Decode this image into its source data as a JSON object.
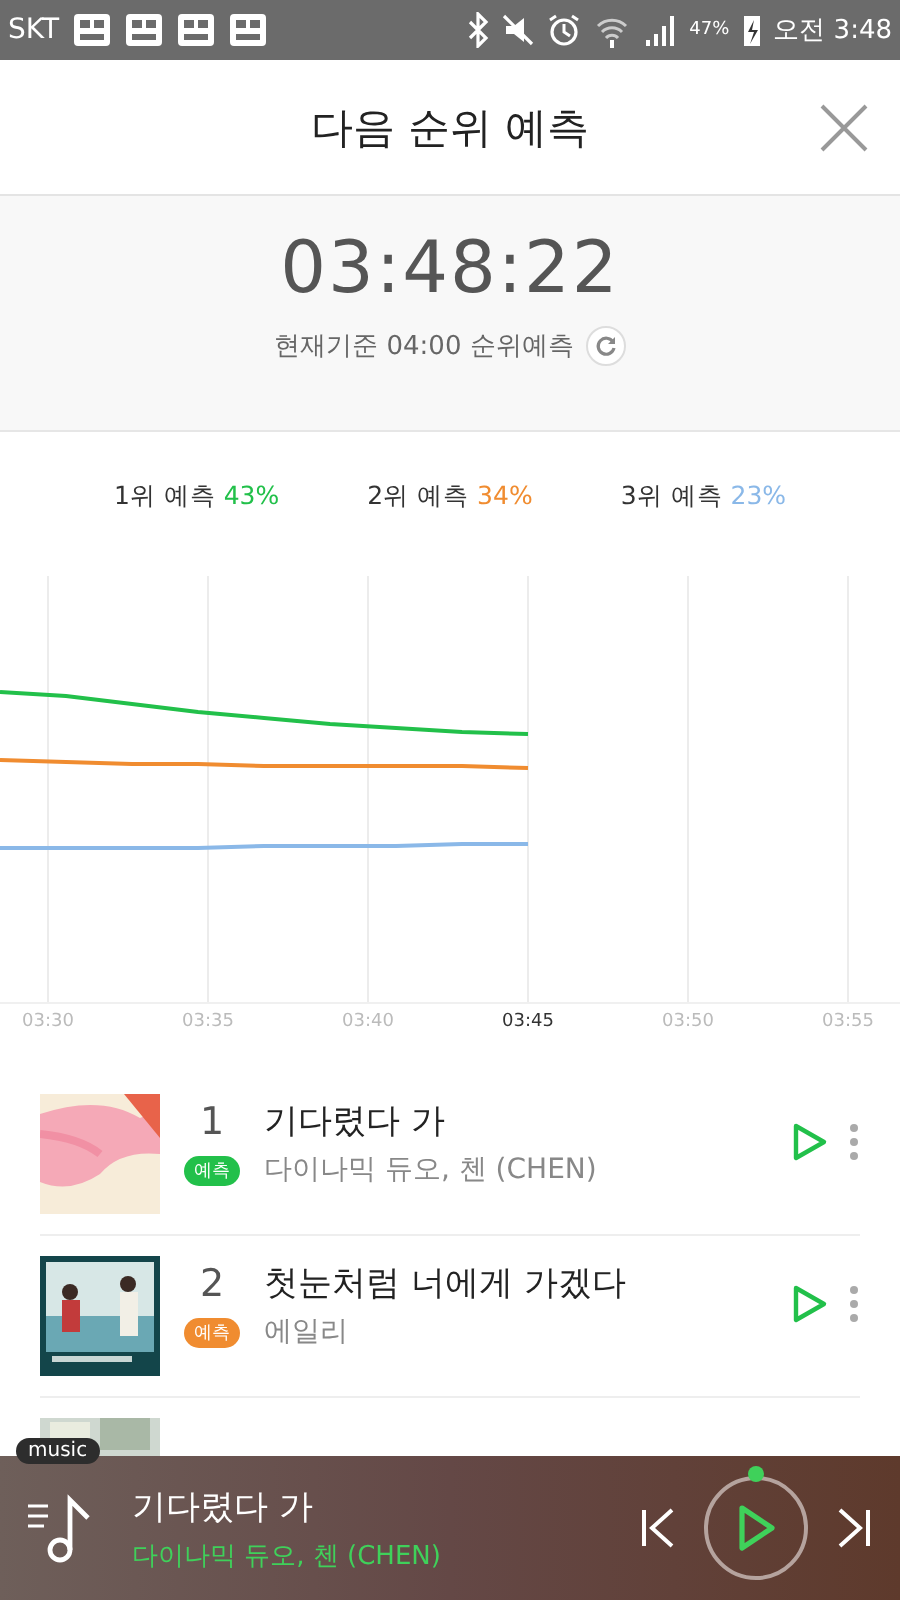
{
  "status_bar": {
    "carrier": "SKT",
    "battery": "47%",
    "time": "오전 3:48"
  },
  "header": {
    "title": "다음 순위 예측"
  },
  "countdown": {
    "time": "03:48:22",
    "caption": "현재기준 04:00 순위예측"
  },
  "legend": [
    {
      "label": "1위 예측",
      "percent": "43%",
      "color": "#22c04a"
    },
    {
      "label": "2위 예측",
      "percent": "34%",
      "color": "#f08c30"
    },
    {
      "label": "3위 예측",
      "percent": "23%",
      "color": "#8ab8e8"
    }
  ],
  "chart": {
    "x_labels": [
      {
        "label": "03:30",
        "current": false
      },
      {
        "label": "03:35",
        "current": false
      },
      {
        "label": "03:40",
        "current": false
      },
      {
        "label": "03:45",
        "current": true
      },
      {
        "label": "03:50",
        "current": false
      },
      {
        "label": "03:55",
        "current": false
      }
    ]
  },
  "songs": [
    {
      "kind": "song",
      "rank": "1",
      "title": "기다렸다 가",
      "artist": "다이나믹 듀오, 첸 (CHEN)",
      "badge": "예측",
      "color": "#22c04a"
    },
    {
      "kind": "song",
      "rank": "2",
      "title": "첫눈처럼 너에게 가겠다",
      "artist": "에일리",
      "badge": "예측",
      "color": "#f08c30"
    },
    {
      "kind": "partial"
    }
  ],
  "player": {
    "badge": "music",
    "title": "기다렸다 가",
    "artist": "다이나믹 듀오, 첸 (CHEN)",
    "playing": false
  }
}
